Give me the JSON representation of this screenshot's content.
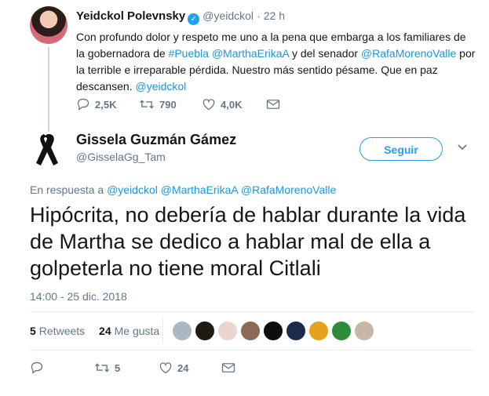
{
  "parent_tweet": {
    "name": "Yeidckol Polevnsky",
    "handle": "@yeidckol",
    "time": "· 22 h",
    "text_segments": [
      {
        "t": "Con profundo dolor y respeto me uno a la pena que embarga a los familiares de la gobernadora de ",
        "link": false
      },
      {
        "t": "#Puebla",
        "link": true
      },
      {
        "t": " ",
        "link": false
      },
      {
        "t": "@MarthaErikaA",
        "link": true
      },
      {
        "t": " y del senador ",
        "link": false
      },
      {
        "t": "@RafaMorenoValle",
        "link": true
      },
      {
        "t": " por la terrible e irreparable pérdida. Nuestro más sentido pésame. Que en paz descansen. ",
        "link": false
      },
      {
        "t": "@yeidckol",
        "link": true
      }
    ],
    "replies": "2,5K",
    "retweets": "790",
    "likes": "4,0K"
  },
  "main_tweet": {
    "name": "Gissela Guzmán Gámez",
    "handle": "@GisselaGg_Tam",
    "follow_label": "Seguir",
    "reply_prefix": "En respuesta a",
    "reply_to": [
      "@yeidckol",
      "@MarthaErikaA",
      "@RafaMorenoValle"
    ],
    "text": "Hipócrita, no debería de hablar durante la vida de Martha se dedico a hablar mal de ella a golpeterla no tiene moral Citlali",
    "timestamp": "14:00 - 25 dic. 2018",
    "retweet_count": "5",
    "retweet_label": "Retweets",
    "like_count": "24",
    "like_label": "Me gusta",
    "action_retweets": "5",
    "action_likes": "24"
  },
  "colors": {
    "accent": "#1da1f2",
    "link": "#1b95e0",
    "muted": "#657786",
    "text": "#14171a",
    "divider": "#e6ecf0"
  },
  "likers": [
    {
      "icon": "default-avatar",
      "color": "#aab8c2"
    },
    {
      "icon": "dark-emblem-avatar",
      "color": "#1f1a12"
    },
    {
      "icon": "flowers-avatar",
      "color": "#e9d6cf"
    },
    {
      "icon": "person-avatar",
      "color": "#8a6a55"
    },
    {
      "icon": "dark-text-avatar",
      "color": "#0d0d0d"
    },
    {
      "icon": "night-avatar",
      "color": "#1d2a4a"
    },
    {
      "icon": "sunset-avatar",
      "color": "#e6a21a"
    },
    {
      "icon": "flag-avatar",
      "color": "#2e8b3a"
    },
    {
      "icon": "man-avatar",
      "color": "#c7b7a8"
    }
  ]
}
